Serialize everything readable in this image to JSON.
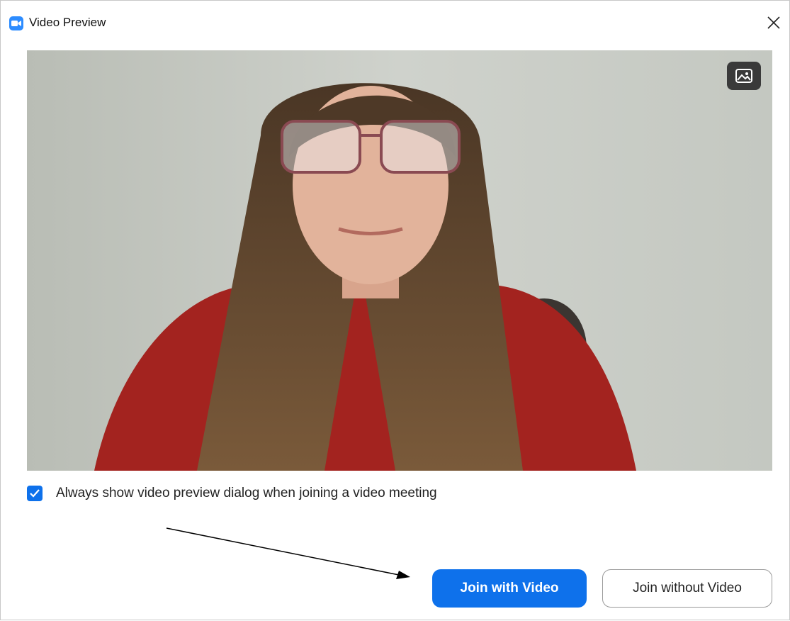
{
  "window": {
    "title": "Video Preview",
    "app_icon": "zoom-camera-icon",
    "close_icon": "close-icon"
  },
  "video_preview": {
    "background_button_icon": "virtual-background-icon"
  },
  "options": {
    "always_show_preview_checked": true,
    "always_show_preview_label": "Always show video preview dialog when joining a video meeting"
  },
  "actions": {
    "join_with_video_label": "Join with Video",
    "join_without_video_label": "Join without Video"
  },
  "colors": {
    "accent": "#0e71eb",
    "app_icon": "#2d8cff"
  }
}
